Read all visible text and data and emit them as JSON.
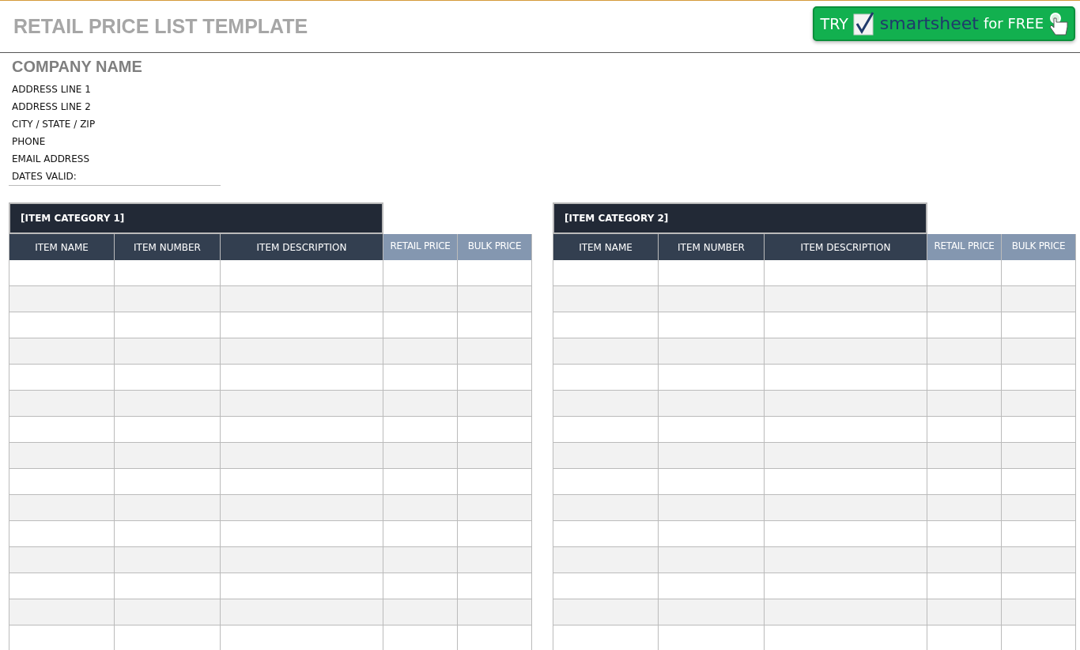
{
  "header": {
    "title": "RETAIL PRICE LIST TEMPLATE",
    "promo": {
      "try": "TRY",
      "brand": "smartsheet",
      "free": "for FREE"
    }
  },
  "company": {
    "name": "COMPANY NAME",
    "lines": [
      "ADDRESS LINE 1",
      "ADDRESS LINE 2",
      "CITY / STATE / ZIP",
      "PHONE",
      "EMAIL ADDRESS",
      "DATES VALID:"
    ]
  },
  "tables": [
    {
      "category": "[ITEM CATEGORY 1]",
      "columns": [
        {
          "label": "ITEM NAME",
          "kind": "dark"
        },
        {
          "label": "ITEM NUMBER",
          "kind": "dark"
        },
        {
          "label": "ITEM DESCRIPTION",
          "kind": "dark"
        },
        {
          "label": "RETAIL PRICE",
          "kind": "light"
        },
        {
          "label": "BULK PRICE",
          "kind": "light"
        }
      ]
    },
    {
      "category": "[ITEM CATEGORY 2]",
      "columns": [
        {
          "label": "ITEM NAME",
          "kind": "dark"
        },
        {
          "label": "ITEM NUMBER",
          "kind": "dark"
        },
        {
          "label": "ITEM DESCRIPTION",
          "kind": "dark"
        },
        {
          "label": "RETAIL PRICE",
          "kind": "light"
        },
        {
          "label": "BULK PRICE",
          "kind": "light"
        }
      ]
    }
  ]
}
